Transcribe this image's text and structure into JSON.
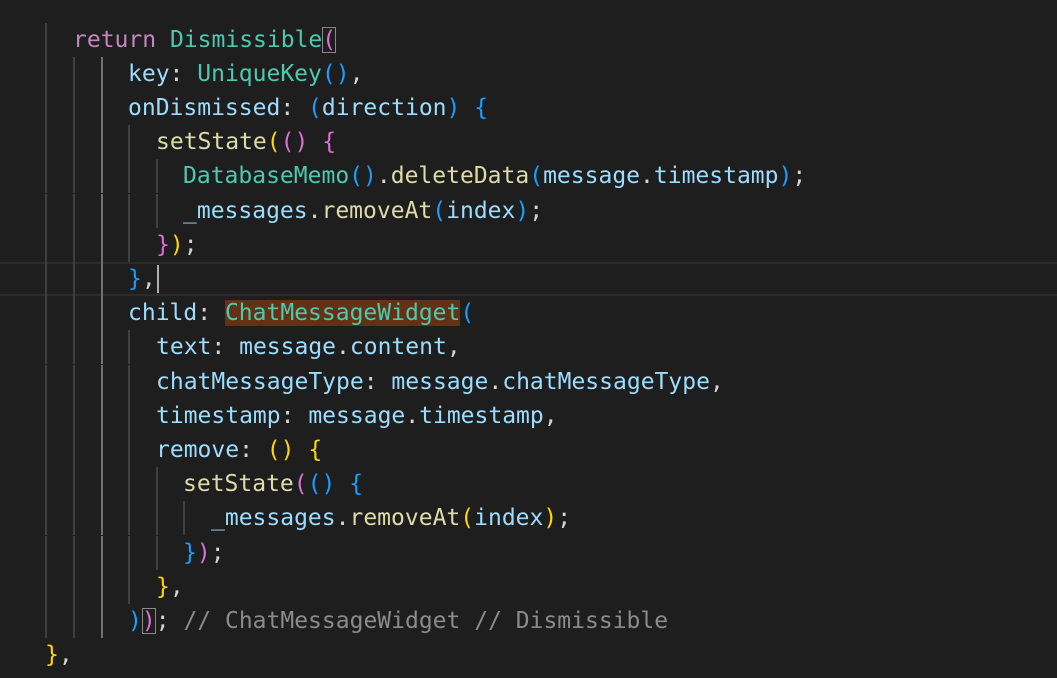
{
  "editor": {
    "language": "dart",
    "colors": {
      "background": "#1e1e1e",
      "keyword": "#c586c0",
      "class": "#4ec9b0",
      "function": "#dcdcaa",
      "property": "#9cdcfe",
      "punctuation": "#d4d4d4",
      "comment": "#8b8b8b",
      "bracket_level1": "#ffd700",
      "bracket_level2": "#da70d6",
      "bracket_level3": "#179fff",
      "word_highlight": "#613214"
    },
    "lines": [
      [
        [
          "return",
          "kw"
        ],
        [
          " ",
          ""
        ],
        [
          "Dismissible",
          "cls"
        ],
        [
          "(",
          "b2 match"
        ]
      ],
      [
        [
          "key",
          "prop"
        ],
        [
          ": ",
          "punc"
        ],
        [
          "UniqueKey",
          "cls"
        ],
        [
          "()",
          "b3"
        ],
        [
          ",",
          "punc"
        ]
      ],
      [
        [
          "onDismissed",
          "prop"
        ],
        [
          ": ",
          "punc"
        ],
        [
          "(",
          "b3"
        ],
        [
          "direction",
          "var"
        ],
        [
          ")",
          "b3"
        ],
        [
          " ",
          ""
        ],
        [
          "{",
          "b3"
        ]
      ],
      [
        [
          "setState",
          "fn"
        ],
        [
          "(",
          "b1"
        ],
        [
          "()",
          "b2"
        ],
        [
          " ",
          ""
        ],
        [
          "{",
          "b2"
        ]
      ],
      [
        [
          "DatabaseMemo",
          "cls"
        ],
        [
          "()",
          "b3"
        ],
        [
          ".",
          "punc"
        ],
        [
          "deleteData",
          "fn"
        ],
        [
          "(",
          "b3"
        ],
        [
          "message",
          "var"
        ],
        [
          ".",
          "punc"
        ],
        [
          "timestamp",
          "prop"
        ],
        [
          ")",
          "b3"
        ],
        [
          ";",
          "punc"
        ]
      ],
      [
        [
          "_messages",
          "var"
        ],
        [
          ".",
          "punc"
        ],
        [
          "removeAt",
          "fn"
        ],
        [
          "(",
          "b3"
        ],
        [
          "index",
          "var"
        ],
        [
          ")",
          "b3"
        ],
        [
          ";",
          "punc"
        ]
      ],
      [
        [
          "}",
          "b2"
        ],
        [
          ")",
          "b1"
        ],
        [
          ";",
          "punc"
        ]
      ],
      [
        [
          "}",
          "b3"
        ],
        [
          ",",
          "punc"
        ]
      ],
      [
        [
          "child",
          "prop"
        ],
        [
          ": ",
          "punc"
        ],
        [
          "ChatMessageWidget",
          "cls hl"
        ],
        [
          "(",
          "b3"
        ]
      ],
      [
        [
          "text",
          "prop"
        ],
        [
          ": ",
          "punc"
        ],
        [
          "message",
          "var"
        ],
        [
          ".",
          "punc"
        ],
        [
          "content",
          "prop"
        ],
        [
          ",",
          "punc"
        ]
      ],
      [
        [
          "chatMessageType",
          "prop"
        ],
        [
          ": ",
          "punc"
        ],
        [
          "message",
          "var"
        ],
        [
          ".",
          "punc"
        ],
        [
          "chatMessageType",
          "prop"
        ],
        [
          ",",
          "punc"
        ]
      ],
      [
        [
          "timestamp",
          "prop"
        ],
        [
          ": ",
          "punc"
        ],
        [
          "message",
          "var"
        ],
        [
          ".",
          "punc"
        ],
        [
          "timestamp",
          "prop"
        ],
        [
          ",",
          "punc"
        ]
      ],
      [
        [
          "remove",
          "prop"
        ],
        [
          ": ",
          "punc"
        ],
        [
          "()",
          "b1"
        ],
        [
          " ",
          ""
        ],
        [
          "{",
          "b1"
        ]
      ],
      [
        [
          "setState",
          "fn"
        ],
        [
          "(",
          "b2"
        ],
        [
          "()",
          "b3"
        ],
        [
          " ",
          ""
        ],
        [
          "{",
          "b3"
        ]
      ],
      [
        [
          "_messages",
          "var"
        ],
        [
          ".",
          "punc"
        ],
        [
          "removeAt",
          "fn"
        ],
        [
          "(",
          "b1"
        ],
        [
          "index",
          "var"
        ],
        [
          ")",
          "b1"
        ],
        [
          ";",
          "punc"
        ]
      ],
      [
        [
          "}",
          "b3"
        ],
        [
          ")",
          "b2"
        ],
        [
          ";",
          "punc"
        ]
      ],
      [
        [
          "}",
          "b1"
        ],
        [
          ",",
          "punc"
        ]
      ],
      [
        [
          ")",
          "b3"
        ],
        [
          ")",
          "b2 match"
        ],
        [
          ";",
          "punc"
        ],
        [
          " ",
          ""
        ],
        [
          "// ChatMessageWidget // Dismissible",
          "cmt"
        ]
      ],
      [
        [
          "}",
          "b1"
        ],
        [
          ",",
          "punc"
        ]
      ]
    ]
  }
}
